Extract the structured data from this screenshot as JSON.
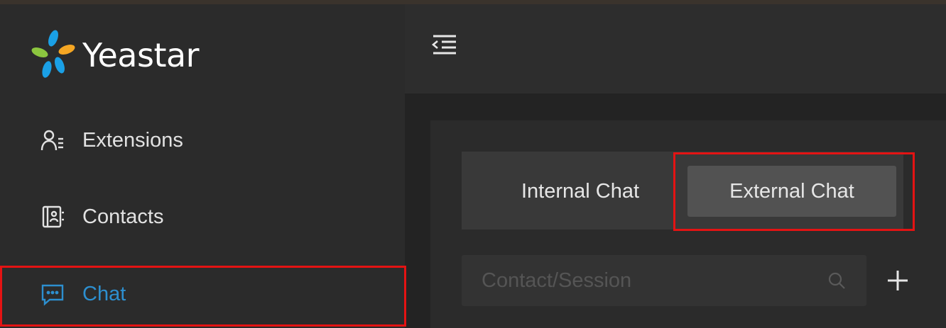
{
  "app": {
    "logo_text": "Yeastar"
  },
  "sidebar": {
    "items": [
      {
        "label": "Extensions",
        "icon": "user-list-icon"
      },
      {
        "label": "Contacts",
        "icon": "address-book-icon"
      },
      {
        "label": "Chat",
        "icon": "chat-bubble-icon",
        "active": true
      }
    ]
  },
  "topbar": {
    "collapse_icon": "menu-collapse-icon"
  },
  "chat": {
    "tabs": [
      {
        "label": "Internal Chat"
      },
      {
        "label": "External Chat",
        "selected": true
      }
    ],
    "search": {
      "placeholder": "Contact/Session",
      "value": ""
    },
    "add_icon": "plus-icon"
  },
  "colors": {
    "accent": "#2d8fcf",
    "highlight_box": "#e41313",
    "sidebar_bg": "#2b2b2b",
    "selected_tab_bg": "#525252"
  }
}
